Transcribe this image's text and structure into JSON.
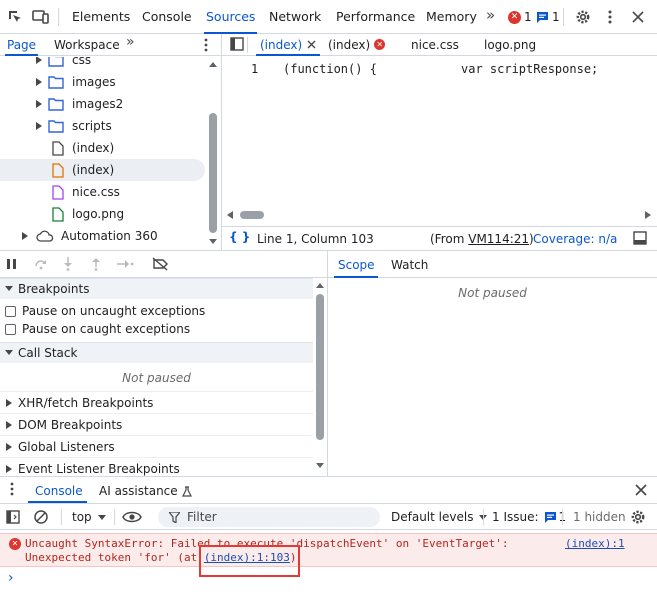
{
  "toolbar": {
    "tabs": [
      "Elements",
      "Console",
      "Sources",
      "Network",
      "Performance",
      "Memory"
    ],
    "active_tab": "Sources",
    "more": "»",
    "error_count": "1",
    "message_count": "1"
  },
  "navigator": {
    "tabs": [
      "Page",
      "Workspace"
    ],
    "more": "»",
    "items": [
      {
        "label": "css",
        "type": "folder"
      },
      {
        "label": "images",
        "type": "folder"
      },
      {
        "label": "images2",
        "type": "folder"
      },
      {
        "label": "scripts",
        "type": "folder"
      },
      {
        "label": "(index)",
        "type": "file-doc"
      },
      {
        "label": "(index)",
        "type": "file-script"
      },
      {
        "label": "nice.css",
        "type": "file-css"
      },
      {
        "label": "logo.png",
        "type": "file-img"
      },
      {
        "label": "Automation 360",
        "type": "cloud"
      }
    ]
  },
  "editor": {
    "tabs": [
      "(index)",
      "(index)",
      "nice.css",
      "logo.png"
    ],
    "line_number": "1",
    "code_left": "(function() {",
    "code_right": "var scriptResponse;",
    "status": {
      "position": "Line 1, Column 103",
      "from_prefix": "(From ",
      "from_link": "VM114:21",
      "from_suffix": ")",
      "coverage": "Coverage: n/a"
    }
  },
  "debugger": {
    "sections": {
      "breakpoints": "Breakpoints",
      "pause_uncaught": "Pause on uncaught exceptions",
      "pause_caught": "Pause on caught exceptions",
      "call_stack": "Call Stack",
      "not_paused": "Not paused",
      "xhr": "XHR/fetch Breakpoints",
      "dom": "DOM Breakpoints",
      "global": "Global Listeners",
      "event": "Event Listener Breakpoints"
    },
    "side_tabs": [
      "Scope",
      "Watch"
    ],
    "scope_not_paused": "Not paused"
  },
  "drawer": {
    "tabs": [
      "Console",
      "AI assistance"
    ],
    "context": "top",
    "filter_placeholder": "Filter",
    "levels": "Default levels",
    "issues_label": "1 Issue:",
    "issues_count": "1",
    "hidden": "1 hidden"
  },
  "console": {
    "error_line1": "Uncaught SyntaxError: Failed to execute 'dispatchEvent' on 'EventTarget':",
    "error_line2_prefix": "Unexpected token 'for' (at ",
    "error_line2_link": "(index):1:103",
    "error_line2_suffix": ")",
    "source_link": "(index):1",
    "prompt": "›"
  },
  "colors": {
    "accent": "#0b57d0",
    "error": "#dc362e",
    "error_bg": "#fcebeb",
    "highlight_box": "#e53935"
  }
}
